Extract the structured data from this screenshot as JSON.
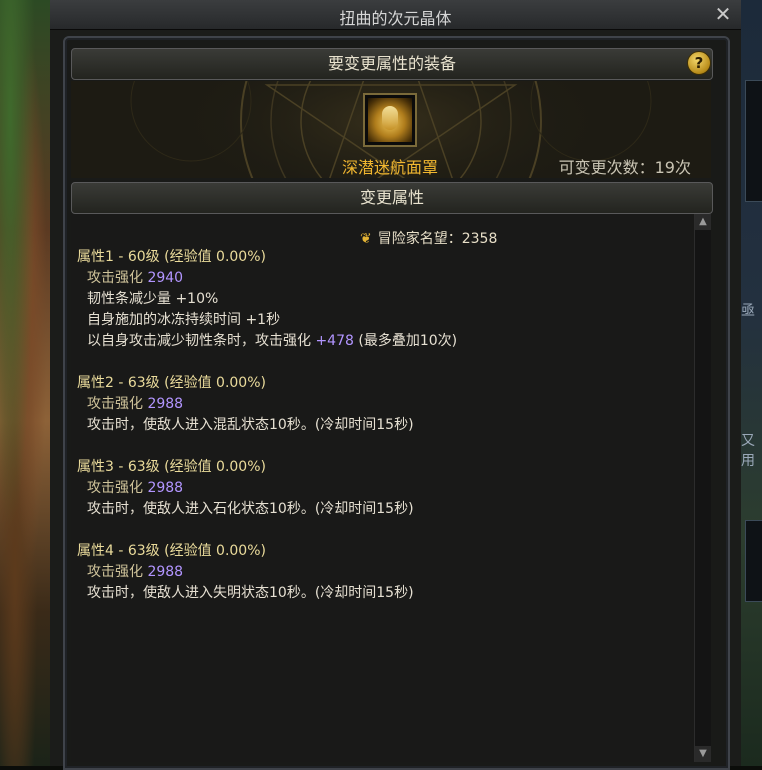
{
  "window": {
    "title": "扭曲的次元晶体",
    "close_glyph": "✕"
  },
  "equip_section": {
    "header": "要变更属性的装备",
    "help_glyph": "?",
    "item_name": "深潜迷航面罩",
    "change_count": "可变更次数：19次"
  },
  "attr_section": {
    "header": "变更属性",
    "fame_label": "冒险家名望：2358",
    "fame_icon": "laurel-icon",
    "groups": [
      {
        "title": "属性1 - 60级 (经验值 0.00%)",
        "stat_label": "攻击强化",
        "stat_value": "2940",
        "effects": [
          {
            "text": "韧性条减少量 +10%"
          },
          {
            "text": "自身施加的冰冻持续时间 +1秒"
          },
          {
            "prefix": "以自身攻击减少韧性条时，攻击强化 ",
            "value": "+478",
            "suffix": " (最多叠加10次)"
          }
        ]
      },
      {
        "title": "属性2 - 63级 (经验值 0.00%)",
        "stat_label": "攻击强化",
        "stat_value": "2988",
        "effects": [
          {
            "text": "攻击时，使敌人进入混乱状态10秒。(冷却时间15秒)"
          }
        ]
      },
      {
        "title": "属性3 - 63级 (经验值 0.00%)",
        "stat_label": "攻击强化",
        "stat_value": "2988",
        "effects": [
          {
            "text": "攻击时，使敌人进入石化状态10秒。(冷却时间15秒)"
          }
        ]
      },
      {
        "title": "属性4 - 63级 (经验值 0.00%)",
        "stat_label": "攻击强化",
        "stat_value": "2988",
        "effects": [
          {
            "text": "攻击时，使敌人进入失明状态10秒。(冷却时间15秒)"
          }
        ]
      }
    ]
  },
  "colors": {
    "item_name": "#f2b830",
    "stat_value": "#b295ff",
    "group_title": "#eadb9b"
  },
  "background_right": {
    "glyph_1": "亟",
    "glyph_2": "又用"
  }
}
